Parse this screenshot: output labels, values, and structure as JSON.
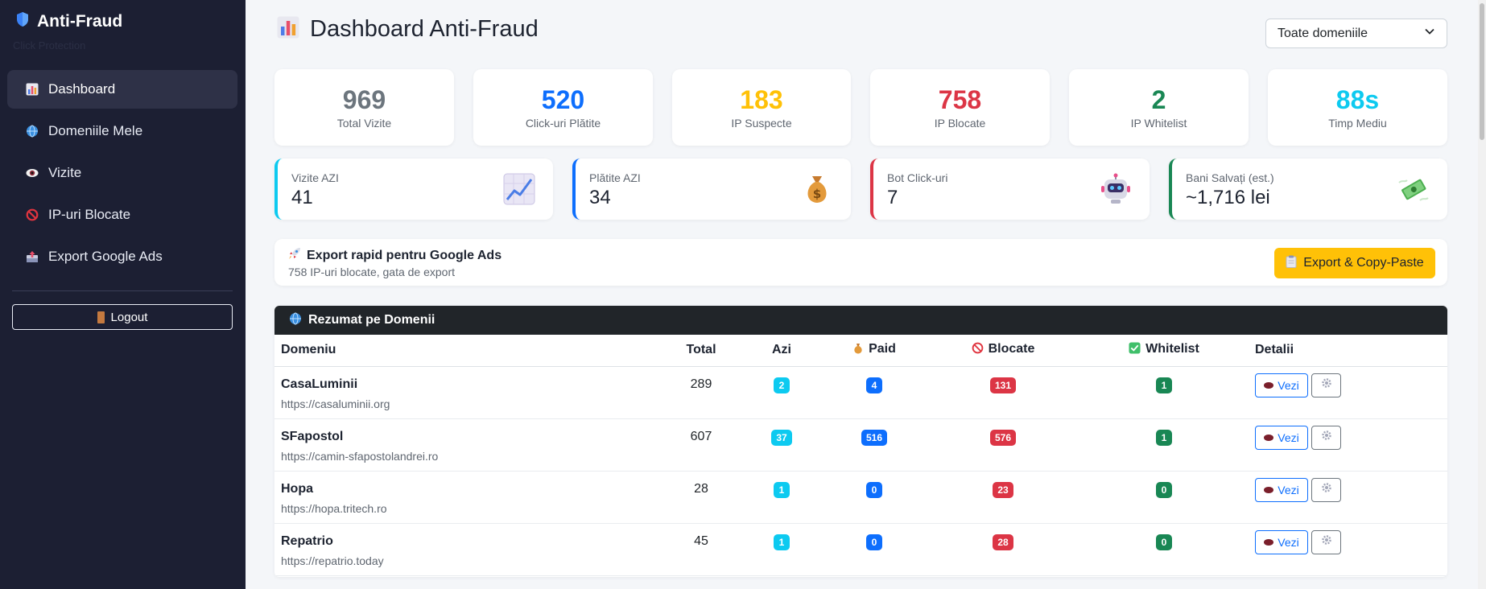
{
  "sidebar": {
    "brand": "Anti-Fraud",
    "subtitle": "Click Protection",
    "items": [
      {
        "label": "Dashboard",
        "icon": "chart-icon",
        "active": true
      },
      {
        "label": "Domeniile Mele",
        "icon": "globe-icon"
      },
      {
        "label": "Vizite",
        "icon": "eye-icon"
      },
      {
        "label": "IP-uri Blocate",
        "icon": "prohibited-icon"
      },
      {
        "label": "Export Google Ads",
        "icon": "outbox-icon"
      }
    ],
    "logout": "Logout"
  },
  "header": {
    "title": "Dashboard Anti-Fraud",
    "domain_select": "Toate domeniile"
  },
  "stats": [
    {
      "value": "969",
      "label": "Total Vizite",
      "color": "#6c757d"
    },
    {
      "value": "520",
      "label": "Click-uri Plătite",
      "color": "#0d6efd"
    },
    {
      "value": "183",
      "label": "IP Suspecte",
      "color": "#ffc107"
    },
    {
      "value": "758",
      "label": "IP Blocate",
      "color": "#dc3545"
    },
    {
      "value": "2",
      "label": "IP Whitelist",
      "color": "#198754"
    },
    {
      "value": "88s",
      "label": "Timp Mediu",
      "color": "#0dcaf0"
    }
  ],
  "today": [
    {
      "label": "Vizite AZI",
      "value": "41",
      "accent": "#0dcaf0",
      "icon": "trending-chart-icon"
    },
    {
      "label": "Plătite AZI",
      "value": "34",
      "accent": "#0d6efd",
      "icon": "money-bag-icon"
    },
    {
      "label": "Bot Click-uri",
      "value": "7",
      "accent": "#dc3545",
      "icon": "robot-icon"
    },
    {
      "label": "Bani Salvați (est.)",
      "value": "~1,716 lei",
      "accent": "#198754",
      "icon": "flying-money-icon"
    }
  ],
  "export": {
    "title": "Export rapid pentru Google Ads",
    "subtitle": "758 IP-uri blocate, gata de export",
    "button": "Export & Copy-Paste"
  },
  "summary": {
    "title": "Rezumat pe Domenii",
    "columns": [
      "Domeniu",
      "Total",
      "Azi",
      "Paid",
      "Blocate",
      "Whitelist",
      "Detalii"
    ],
    "view_label": "Vezi",
    "rows": [
      {
        "name": "CasaLuminii",
        "url": "https://casaluminii.org",
        "total": "289",
        "azi": "2",
        "paid": "4",
        "blocate": "131",
        "whitelist": "1"
      },
      {
        "name": "SFapostol",
        "url": "https://camin-sfapostolandrei.ro",
        "total": "607",
        "azi": "37",
        "paid": "516",
        "blocate": "576",
        "whitelist": "1"
      },
      {
        "name": "Hopa",
        "url": "https://hopa.tritech.ro",
        "total": "28",
        "azi": "1",
        "paid": "0",
        "blocate": "23",
        "whitelist": "0"
      },
      {
        "name": "Repatrio",
        "url": "https://repatrio.today",
        "total": "45",
        "azi": "1",
        "paid": "0",
        "blocate": "28",
        "whitelist": "0"
      }
    ]
  }
}
